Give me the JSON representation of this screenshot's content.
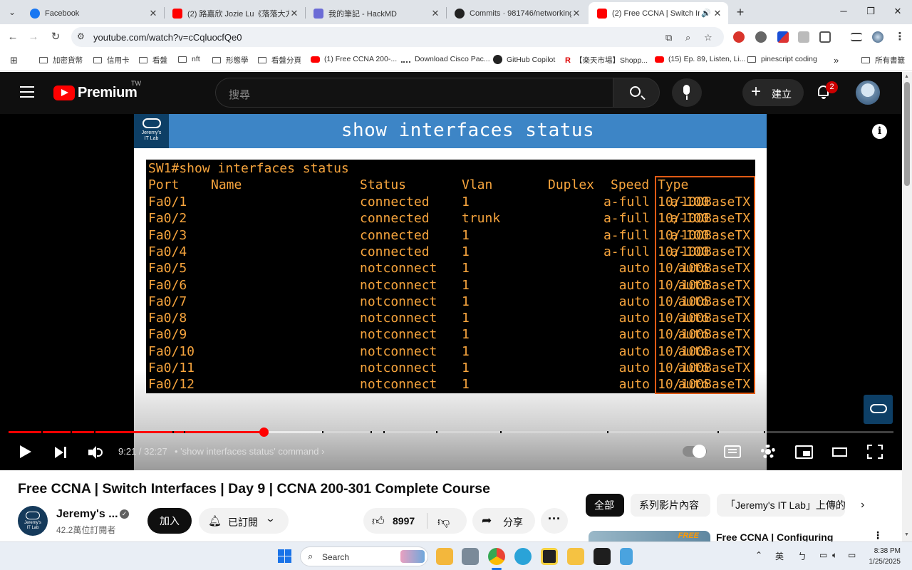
{
  "browser": {
    "tabs": [
      {
        "title": "Facebook",
        "favicon": "facebook-icon"
      },
      {
        "title": "(2) 路嘉欣 Jozie Lu《落落大方 F",
        "favicon": "youtube-icon"
      },
      {
        "title": "我的筆記 - HackMD",
        "favicon": "hackmd-icon"
      },
      {
        "title": "Commits · 981746/networking-",
        "favicon": "github-icon"
      },
      {
        "title": "(2) Free CCNA | Switch Inte",
        "favicon": "youtube-icon",
        "active": true
      }
    ],
    "url": "youtube.com/watch?v=cCqluocfQe0",
    "bookmarks": [
      "加密貨幣",
      "信用卡",
      "看盤",
      "nft",
      "形態學",
      "看盤分頁",
      "(1) Free CCNA 200-...",
      "Download Cisco Pac...",
      "GitHub Copilot",
      "【楽天市場】Shopp...",
      "(15) Ep. 89, Listen, Li...",
      "pinescript coding",
      "所有書籤"
    ]
  },
  "youtube": {
    "logo_text": "Premium",
    "region": "TW",
    "search_placeholder": "搜尋",
    "create_label": "建立",
    "notification_count": "2"
  },
  "slide": {
    "title": "show interfaces status",
    "logo_line1": "Jeremy's",
    "logo_line2": "IT Lab"
  },
  "terminal": {
    "prompt": "SW1#show interfaces status",
    "headers": {
      "port": "Port",
      "name": "Name",
      "status": "Status",
      "vlan": "Vlan",
      "duplex": "Duplex",
      "speed": "Speed",
      "type": "Type"
    },
    "rows": [
      {
        "port": "Fa0/1",
        "status": "connected",
        "vlan": "1",
        "duplex": "a-full",
        "speed": "a-100",
        "type": "10/100BaseTX"
      },
      {
        "port": "Fa0/2",
        "status": "connected",
        "vlan": "trunk",
        "duplex": "a-full",
        "speed": "a-100",
        "type": "10/100BaseTX"
      },
      {
        "port": "Fa0/3",
        "status": "connected",
        "vlan": "1",
        "duplex": "a-full",
        "speed": "a-100",
        "type": "10/100BaseTX"
      },
      {
        "port": "Fa0/4",
        "status": "connected",
        "vlan": "1",
        "duplex": "a-full",
        "speed": "a-100",
        "type": "10/100BaseTX"
      },
      {
        "port": "Fa0/5",
        "status": "notconnect",
        "vlan": "1",
        "duplex": "auto",
        "speed": "auto",
        "type": "10/100BaseTX"
      },
      {
        "port": "Fa0/6",
        "status": "notconnect",
        "vlan": "1",
        "duplex": "auto",
        "speed": "auto",
        "type": "10/100BaseTX"
      },
      {
        "port": "Fa0/7",
        "status": "notconnect",
        "vlan": "1",
        "duplex": "auto",
        "speed": "auto",
        "type": "10/100BaseTX"
      },
      {
        "port": "Fa0/8",
        "status": "notconnect",
        "vlan": "1",
        "duplex": "auto",
        "speed": "auto",
        "type": "10/100BaseTX"
      },
      {
        "port": "Fa0/9",
        "status": "notconnect",
        "vlan": "1",
        "duplex": "auto",
        "speed": "auto",
        "type": "10/100BaseTX"
      },
      {
        "port": "Fa0/10",
        "status": "notconnect",
        "vlan": "1",
        "duplex": "auto",
        "speed": "auto",
        "type": "10/100BaseTX"
      },
      {
        "port": "Fa0/11",
        "status": "notconnect",
        "vlan": "1",
        "duplex": "auto",
        "speed": "auto",
        "type": "10/100BaseTX"
      },
      {
        "port": "Fa0/12",
        "status": "notconnect",
        "vlan": "1",
        "duplex": "auto",
        "speed": "auto",
        "type": "10/100BaseTX"
      }
    ]
  },
  "player": {
    "current_time": "9:21",
    "duration": "32:27",
    "time_display": "9:21 / 32:27",
    "chapter": "'show interfaces status' command",
    "progress_fraction": 0.288,
    "buffered_fraction": 0.355
  },
  "video": {
    "title": "Free CCNA | Switch Interfaces | Day 9 | CCNA 200-301 Complete Course",
    "channel": "Jeremy's ...",
    "subscribers": "42.2萬位訂閱者",
    "join_label": "加入",
    "subscribed_label": "已訂閱",
    "likes": "8997",
    "share_label": "分享"
  },
  "related": {
    "chips": [
      "全部",
      "系列影片內容",
      "「Jeremy's IT Lab」上傳的"
    ],
    "first_title": "Free CCNA | Configuring",
    "thumb_badge": "FREE"
  },
  "taskbar": {
    "search_label": "Search",
    "ime": "英",
    "time": "8:38 PM",
    "date": "1/25/2025"
  },
  "colors": {
    "yt_red": "#ff0000",
    "terminal_text": "#f6a43d",
    "type_highlight": "#e05a14",
    "slide_header": "#3d85c6"
  }
}
